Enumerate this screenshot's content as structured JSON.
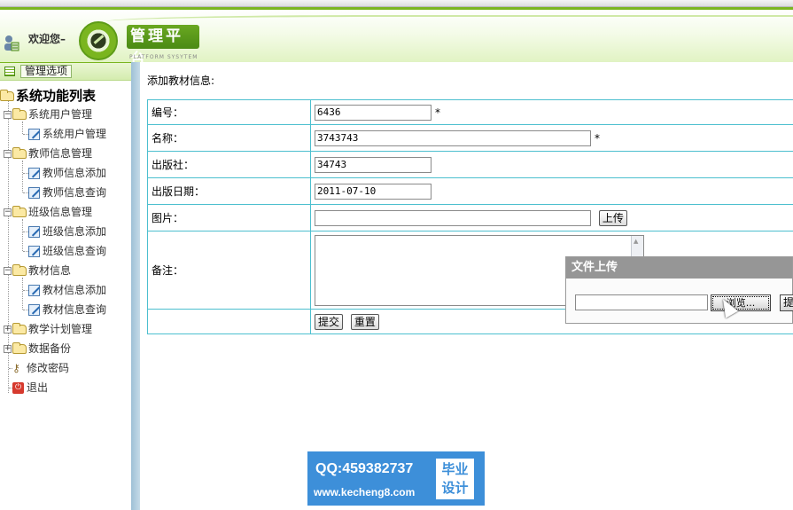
{
  "header": {
    "welcome": "欢迎您–",
    "brand": "管理平台",
    "brand_sub": "PLATFORM SYSYTEM"
  },
  "sidebar": {
    "title": "管理选项",
    "root": "系统功能列表",
    "groups": [
      {
        "label": "系统用户管理",
        "expanded": true,
        "items": [
          "系统用户管理"
        ]
      },
      {
        "label": "教师信息管理",
        "expanded": true,
        "items": [
          "教师信息添加",
          "教师信息查询"
        ]
      },
      {
        "label": "班级信息管理",
        "expanded": true,
        "items": [
          "班级信息添加",
          "班级信息查询"
        ]
      },
      {
        "label": "教材信息",
        "expanded": true,
        "items": [
          "教材信息添加",
          "教材信息查询"
        ]
      },
      {
        "label": "教学计划管理",
        "expanded": false,
        "items": []
      },
      {
        "label": "数据备份",
        "expanded": false,
        "items": []
      }
    ],
    "change_password": "修改密码",
    "exit": "退出"
  },
  "form": {
    "heading": "添加教材信息:",
    "fields": {
      "code": {
        "label": "编号：",
        "value": "6436",
        "required": "*"
      },
      "name": {
        "label": "名称：",
        "value": "3743743",
        "required": "*"
      },
      "publisher": {
        "label": "出版社：",
        "value": "34743"
      },
      "pub_date": {
        "label": "出版日期：",
        "value": "2011-07-10"
      },
      "image": {
        "label": "图片：",
        "value": "",
        "upload_button": "上传"
      },
      "remark": {
        "label": "备注：",
        "value": ""
      }
    },
    "submit": "提交",
    "reset": "重置"
  },
  "upload_dialog": {
    "title": "文件上传",
    "browse": "浏览...",
    "submit": "提"
  },
  "watermark": {
    "qq": "QQ:459382737",
    "site": "www.kecheng8.com",
    "stamp_line1": "毕业",
    "stamp_line2": "设计"
  }
}
